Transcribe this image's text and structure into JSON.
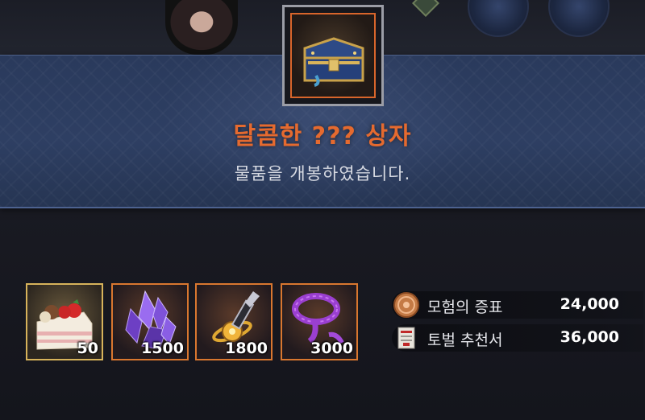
{
  "banner": {
    "item_icon": "treasure-chest-icon",
    "title": "달콤한 ??? 상자",
    "subtitle": "물품을 개봉하였습니다."
  },
  "rewards": [
    {
      "name": "cake",
      "icon": "strawberry-cake-icon",
      "quantity": "50",
      "grade": "gold"
    },
    {
      "name": "crystal",
      "icon": "purple-crystal-icon",
      "quantity": "1500",
      "grade": "orange"
    },
    {
      "name": "potion",
      "icon": "golden-potion-icon",
      "quantity": "1800",
      "grade": "orange"
    },
    {
      "name": "rope",
      "icon": "purple-rope-icon",
      "quantity": "3000",
      "grade": "orange"
    }
  ],
  "currencies": [
    {
      "icon": "adventure-coin-icon",
      "label": "모험의 증표",
      "value": "24,000"
    },
    {
      "icon": "subjugation-scroll-icon",
      "label": "토벌 추천서",
      "value": "36,000"
    }
  ],
  "colors": {
    "title": "#e56a2f",
    "banner": "#2e3f63",
    "slot_orange": "#d9772f",
    "slot_gold": "#d7b35b"
  }
}
